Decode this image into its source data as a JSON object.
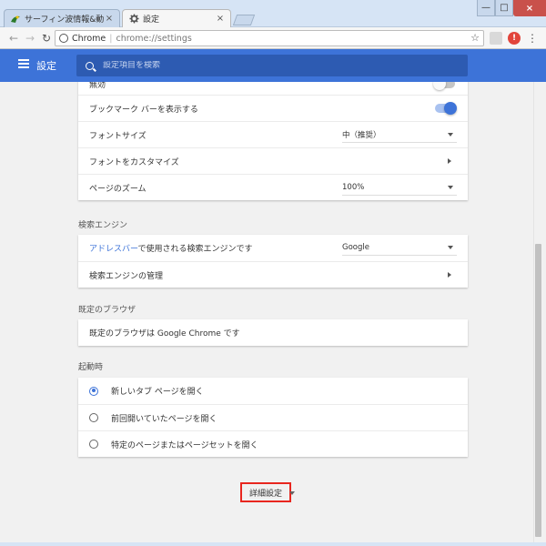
{
  "browser": {
    "tabs": [
      {
        "label": "サーフィン波情報&動画",
        "icon": "surf-favicon-icon",
        "active": false
      },
      {
        "label": "設定",
        "icon": "gear-icon",
        "active": true
      }
    ],
    "tab_close_glyph": "×",
    "omnibox": {
      "origin": "Chrome",
      "separator": "|",
      "url": "chrome://settings"
    },
    "window_controls": {
      "minimize": "—",
      "maximize": "□",
      "close": "×"
    },
    "extension_two_label": "!"
  },
  "appbar": {
    "title": "設定",
    "search_placeholder": "設定項目を検索"
  },
  "appearance": {
    "rows": [
      {
        "label": "無効",
        "control": "toggle",
        "state": "off"
      },
      {
        "label": "ブックマーク バーを表示する",
        "control": "toggle",
        "state": "on"
      },
      {
        "label": "フォントサイズ",
        "control": "select",
        "value": "中（推奨）"
      },
      {
        "label": "フォントをカスタマイズ",
        "control": "arrow"
      },
      {
        "label": "ページのズーム",
        "control": "select",
        "value": "100%"
      }
    ]
  },
  "search_engine": {
    "title": "検索エンジン",
    "row1_link": "アドレスバー",
    "row1_text": "で使用される検索エンジンです",
    "row1_value": "Google",
    "row2_label": "検索エンジンの管理"
  },
  "default_browser": {
    "title": "既定のブラウザ",
    "text": "既定のブラウザは Google Chrome です"
  },
  "startup": {
    "title": "起動時",
    "options": [
      {
        "label": "新しいタブ ページを開く",
        "selected": true
      },
      {
        "label": "前回開いていたページを開く",
        "selected": false
      },
      {
        "label": "特定のページまたはページセットを開く",
        "selected": false
      }
    ]
  },
  "advanced_label": "詳細設定",
  "colors": {
    "accent": "#3d73d8",
    "header": "#3d73d8",
    "highlight_border": "#e8261f"
  }
}
